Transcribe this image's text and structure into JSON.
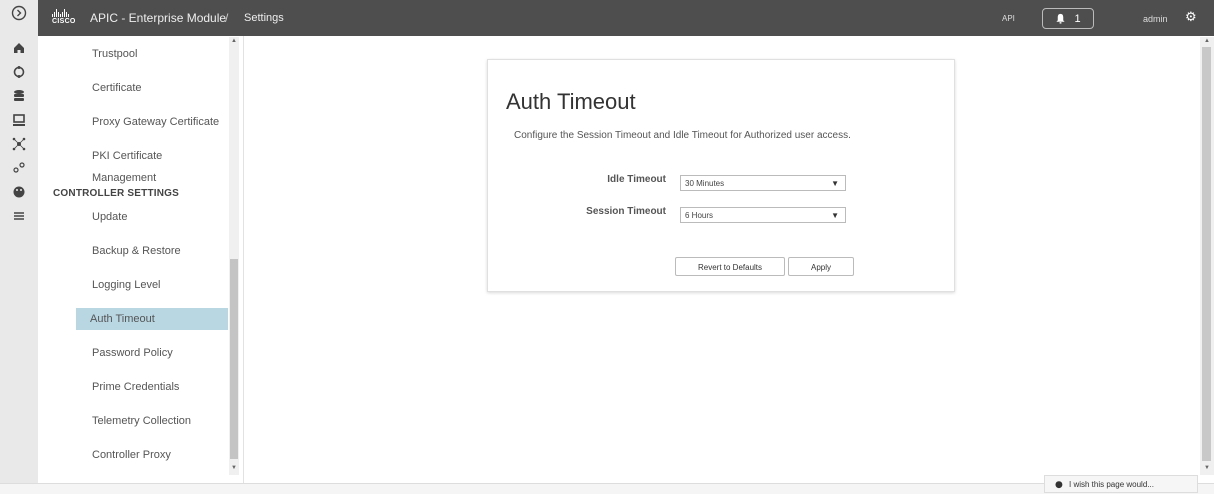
{
  "header": {
    "app_title": "APIC - Enterprise Module",
    "separator": "/",
    "breadcrumb": "Settings",
    "logo_text": "CISCO",
    "api_label": "API",
    "notification_count": "1",
    "user": "admin"
  },
  "left_rail": {
    "icons": [
      "expand-icon",
      "home-icon",
      "topology-icon",
      "database-icon",
      "device-icon",
      "network-icon",
      "location-icon",
      "palette-icon",
      "policy-icon"
    ]
  },
  "sidebar": {
    "items_top": [
      "Trustpool",
      "Certificate",
      "Proxy Gateway Certificate",
      "PKI Certificate Management"
    ],
    "section_title": "CONTROLLER SETTINGS",
    "items_controller": [
      "Update",
      "Backup & Restore",
      "Logging Level",
      "Auth Timeout",
      "Password Policy",
      "Prime Credentials",
      "Telemetry Collection",
      "Controller Proxy"
    ],
    "active_item": "Auth Timeout"
  },
  "card": {
    "title": "Auth Timeout",
    "description": "Configure the Session Timeout and Idle Timeout for Authorized user access.",
    "idle_label": "Idle Timeout",
    "idle_value": "30 Minutes",
    "session_label": "Session Timeout",
    "session_value": "6 Hours",
    "revert_label": "Revert to Defaults",
    "apply_label": "Apply"
  },
  "feedback": {
    "label": "I wish this page would..."
  },
  "colors": {
    "topbar": "#4e4e4e",
    "active_item": "#b8d7e3"
  }
}
